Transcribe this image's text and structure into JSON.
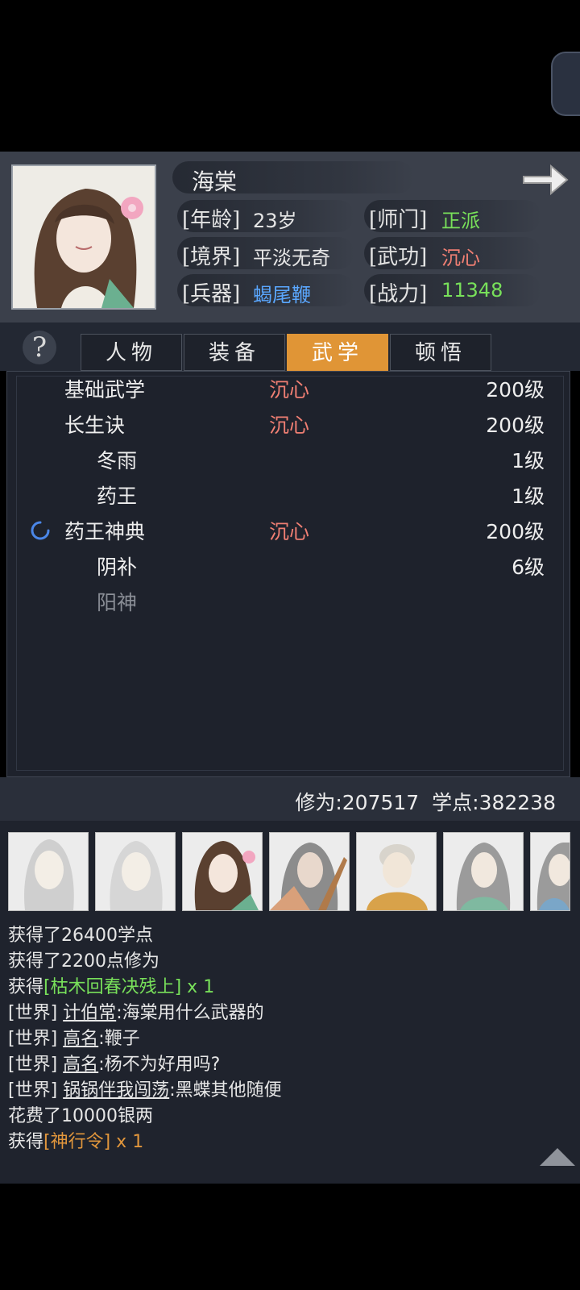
{
  "character": {
    "name": "海棠",
    "stats": [
      {
        "label": "[年龄]",
        "value": "23岁",
        "color": "#ececec"
      },
      {
        "label": "[师门]",
        "value": "正派",
        "color": "#78e05a"
      },
      {
        "label": "[境界]",
        "value": "平淡无奇",
        "color": "#ececec"
      },
      {
        "label": "[武功]",
        "value": "沉心",
        "color": "#f07f73"
      },
      {
        "label": "[兵器]",
        "value": "蝎尾鞭",
        "color": "#5aa7ff"
      },
      {
        "label": "[战力]",
        "value": "11348",
        "color": "#78e05a"
      }
    ]
  },
  "tabs": [
    {
      "label": "人物",
      "active": false
    },
    {
      "label": "装备",
      "active": false
    },
    {
      "label": "武学",
      "active": true
    },
    {
      "label": "顿悟",
      "active": false
    }
  ],
  "help_label": "?",
  "skills": [
    {
      "name": "基础武学",
      "state": "沉心",
      "level": "200级",
      "indent": false,
      "dim": false,
      "loading": false
    },
    {
      "name": "长生诀",
      "state": "沉心",
      "level": "200级",
      "indent": false,
      "dim": false,
      "loading": false
    },
    {
      "name": "冬雨",
      "state": "",
      "level": "1级",
      "indent": true,
      "dim": false,
      "loading": false
    },
    {
      "name": "药王",
      "state": "",
      "level": "1级",
      "indent": true,
      "dim": false,
      "loading": false
    },
    {
      "name": "药王神典",
      "state": "沉心",
      "level": "200级",
      "indent": false,
      "dim": false,
      "loading": true
    },
    {
      "name": "阴补",
      "state": "",
      "level": "6级",
      "indent": true,
      "dim": false,
      "loading": false
    },
    {
      "name": "阳神",
      "state": "",
      "level": "",
      "indent": true,
      "dim": true,
      "loading": false
    }
  ],
  "footer": {
    "xiuwei_label": "修为:",
    "xiuwei": "207517",
    "xuedian_label": "学点:",
    "xuedian": "382238"
  },
  "log": [
    {
      "parts": [
        {
          "t": "获得了26400学点",
          "c": "#e6e6e6"
        }
      ]
    },
    {
      "parts": [
        {
          "t": "获得了2200点修为",
          "c": "#e6e6e6"
        }
      ]
    },
    {
      "parts": [
        {
          "t": "获得",
          "c": "#e6e6e6"
        },
        {
          "t": "[枯木回春决残上]",
          "c": "#78e05a"
        },
        {
          "t": " x 1",
          "c": "#78e05a"
        }
      ]
    },
    {
      "parts": [
        {
          "t": "[世界] ",
          "c": "#e6e6e6"
        },
        {
          "t": "计伯常",
          "c": "#e6e6e6",
          "u": true
        },
        {
          "t": ":海棠用什么武器的",
          "c": "#e6e6e6"
        }
      ]
    },
    {
      "parts": [
        {
          "t": "[世界] ",
          "c": "#e6e6e6"
        },
        {
          "t": "高名",
          "c": "#e6e6e6",
          "u": true
        },
        {
          "t": ":鞭子",
          "c": "#e6e6e6"
        }
      ]
    },
    {
      "parts": [
        {
          "t": "[世界] ",
          "c": "#e6e6e6"
        },
        {
          "t": "高名",
          "c": "#e6e6e6",
          "u": true
        },
        {
          "t": ":杨不为好用吗?",
          "c": "#e6e6e6"
        }
      ]
    },
    {
      "parts": [
        {
          "t": "[世界] ",
          "c": "#e6e6e6"
        },
        {
          "t": "锅锅伴我闯荡",
          "c": "#e6e6e6",
          "u": true
        },
        {
          "t": ":黑蝶其他随便",
          "c": "#e6e6e6"
        }
      ]
    },
    {
      "parts": [
        {
          "t": "花费了10000银两",
          "c": "#e6e6e6"
        }
      ]
    },
    {
      "parts": [
        {
          "t": "获得",
          "c": "#e6e6e6"
        },
        {
          "t": "[神行令]",
          "c": "#e1963c"
        },
        {
          "t": " x 1",
          "c": "#e1963c"
        }
      ]
    }
  ]
}
